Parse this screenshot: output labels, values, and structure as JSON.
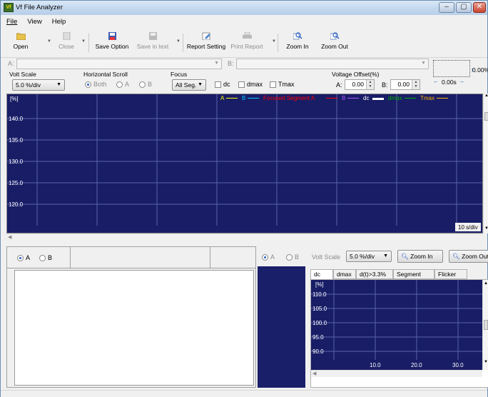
{
  "window": {
    "title": "Vf File Analyzer",
    "min_icon": "minimize-icon",
    "max_icon": "maximize-icon",
    "close_glyph": "✕"
  },
  "menu": [
    "File",
    "View",
    "Help"
  ],
  "toolbar": {
    "open": "Open",
    "close": "Close",
    "save_option": "Save Option",
    "save_in_text": "Save in text",
    "report_setting": "Report Setting",
    "print_report": "Print Report",
    "zoom_in": "Zoom In",
    "zoom_out": "Zoom Out"
  },
  "files": {
    "a_label": "A:",
    "b_label": "B:"
  },
  "volt_scale": {
    "label": "Volt Scale",
    "value": "5.0 %/div"
  },
  "horizontal_scroll": {
    "label": "Horizontal Scroll",
    "options": [
      "Both",
      "A",
      "B"
    ]
  },
  "focus": {
    "label": "Focus",
    "value": "All Seg.",
    "checks": [
      "dc",
      "dmax",
      "Tmax"
    ]
  },
  "voltage_offset": {
    "label": "Voltage Offset(%)",
    "a_label": "A:",
    "a_value": "0.00",
    "b_label": "B:",
    "b_value": "0.00"
  },
  "scale_indicator": {
    "voltage": "0.00%",
    "time": "0.00s"
  },
  "main_chart": {
    "unit": "[%]",
    "y_ticks": [
      "140.0",
      "135.0",
      "130.0",
      "125.0",
      "120.0"
    ],
    "time_div": "10 s/div",
    "legend": [
      {
        "label": "A",
        "color": "#ffff00"
      },
      {
        "label": "B",
        "color": "#00c8ff"
      },
      {
        "label": "Focused Segment A",
        "color": "#ff0000"
      },
      {
        "label": "B",
        "color": "#b050ff"
      },
      {
        "label": "dc",
        "color": "#ffffff"
      },
      {
        "label": "dmax",
        "color": "#00b000"
      },
      {
        "label": "Tmax",
        "color": "#ffb000"
      }
    ]
  },
  "left_panel": {
    "options": [
      "A",
      "B"
    ]
  },
  "right_panel": {
    "options": [
      "A",
      "B"
    ],
    "volt_scale_label": "Volt Scale",
    "volt_scale_value": "5.0 %/div",
    "zoom_in": "Zoom In",
    "zoom_out": "Zoom Out",
    "tabs": [
      "dc",
      "dmax",
      "d(t)>3.3%",
      "Segment Info",
      "Flicker List"
    ],
    "chart": {
      "unit": "[%]",
      "y_ticks": [
        "110.0",
        "105.0",
        "100.0",
        "95.0",
        "90.0"
      ],
      "x_ticks": [
        "10.0",
        "20.0",
        "30.0"
      ]
    }
  },
  "colors": {
    "chart_bg": "#181d66",
    "grid": "#5a62a8",
    "accent": "#2860c8"
  }
}
